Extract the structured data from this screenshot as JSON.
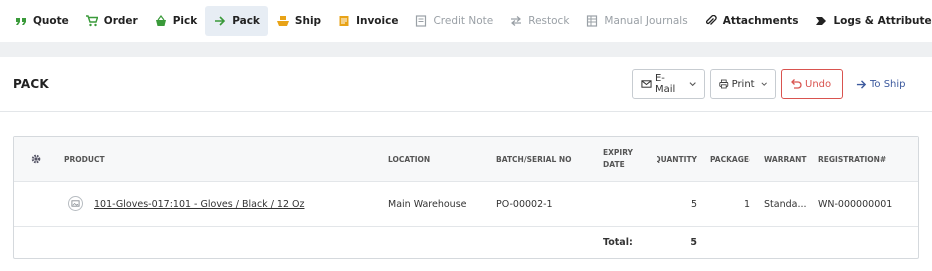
{
  "tabs": [
    {
      "label": "Quote",
      "icon": "quote-icon",
      "color": "#3a9a3a",
      "state": "normal"
    },
    {
      "label": "Order",
      "icon": "cart-icon",
      "color": "#3a9a3a",
      "state": "normal"
    },
    {
      "label": "Pick",
      "icon": "basket-icon",
      "color": "#3a9a3a",
      "state": "normal"
    },
    {
      "label": "Pack",
      "icon": "arrow-right-icon",
      "color": "#3a9a3a",
      "state": "active"
    },
    {
      "label": "Ship",
      "icon": "ship-icon",
      "color": "#e8a317",
      "state": "normal"
    },
    {
      "label": "Invoice",
      "icon": "invoice-icon",
      "color": "#e8a317",
      "state": "normal"
    },
    {
      "label": "Credit Note",
      "icon": "credit-note-icon",
      "color": "#9aa0a6",
      "state": "disabled"
    },
    {
      "label": "Restock",
      "icon": "restock-icon",
      "color": "#9aa0a6",
      "state": "disabled"
    },
    {
      "label": "Manual Journals",
      "icon": "journal-icon",
      "color": "#9aa0a6",
      "state": "disabled"
    },
    {
      "label": "Attachments",
      "icon": "paperclip-icon",
      "color": "#222222",
      "state": "normal"
    },
    {
      "label": "Logs & Attributes",
      "icon": "tag-icon",
      "color": "#222222",
      "state": "normal"
    }
  ],
  "header": {
    "title": "PACK",
    "email_label": "E-Mail",
    "print_label": "Print",
    "undo_label": "Undo",
    "toship_label": "To Ship",
    "undo_color": "#d9534f",
    "link_color": "#3d5a9e"
  },
  "table": {
    "columns": {
      "product": "PRODUCT",
      "location": "LOCATION",
      "batch": "BATCH/SERIAL NO",
      "expiry": "EXPIRY DATE",
      "quantity": "QUANTITY",
      "package": "PACKAGE#",
      "warranty": "WARRANT",
      "registration": "REGISTRATION#"
    },
    "rows": [
      {
        "product": "101-Gloves-017:101 - Gloves / Black / 12 Oz",
        "location": "Main Warehouse",
        "batch": "PO-00002-1",
        "expiry": "",
        "quantity": "5",
        "package": "1",
        "warranty": "Standa...",
        "registration": "WN-000000001"
      }
    ],
    "total_label": "Total:",
    "total_quantity": "5"
  }
}
